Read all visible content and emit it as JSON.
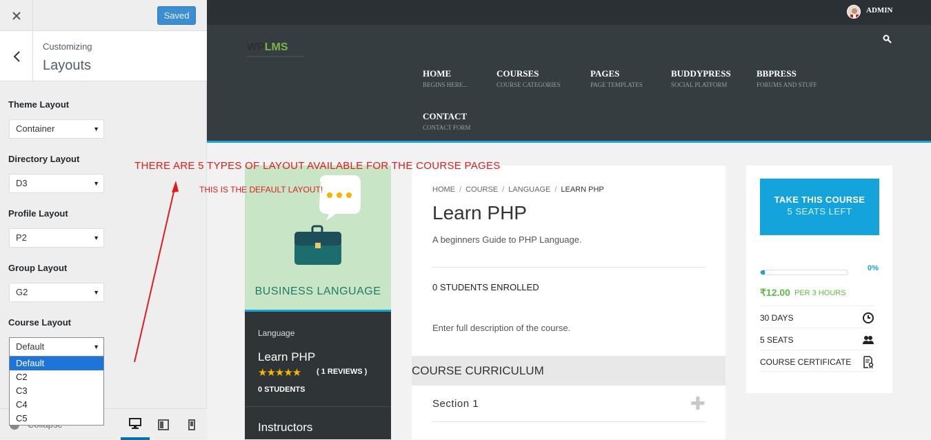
{
  "sidebar": {
    "close_icon": "close-icon",
    "saved_label": "Saved",
    "customizing_label": "Customizing",
    "section_title": "Layouts",
    "controls": [
      {
        "label": "Theme Layout",
        "value": "Container"
      },
      {
        "label": "Directory Layout",
        "value": "D3"
      },
      {
        "label": "Profile Layout",
        "value": "P2"
      },
      {
        "label": "Group Layout",
        "value": "G2"
      },
      {
        "label": "Course Layout",
        "value": "Default"
      }
    ],
    "course_layout_options": [
      "Default",
      "C2",
      "C3",
      "C4",
      "C5"
    ],
    "collapse_label": "Collapse",
    "accent_color": "#0073aa"
  },
  "preview": {
    "admin_name": "ADMIN",
    "logo": {
      "wp": "WP",
      "lms": "LMS"
    },
    "nav": [
      {
        "label": "HOME",
        "sub": "BEGINS HERE..."
      },
      {
        "label": "COURSES",
        "sub": "COURSE CATEGORIES"
      },
      {
        "label": "PAGES",
        "sub": "PAGE TEMPLATES"
      },
      {
        "label": "BUDDYPRESS",
        "sub": "SOCIAL PLATFORM"
      },
      {
        "label": "BBPRESS",
        "sub": "FORUMS AND STUFF"
      },
      {
        "label": "CONTACT",
        "sub": "CONTACT FORM"
      }
    ],
    "annotations": {
      "main": "THERE ARE 5 TYPES OF LAYOUT AVAILABLE FOR THE COURSE PAGES",
      "sub": "THIS IS THE DEFAULT LAYOUT!"
    },
    "course_card": {
      "image_caption": "BUSINESS LANGUAGE",
      "category": "Language",
      "title": "Learn PHP",
      "rating": 5,
      "reviews": "( 1 REVIEWS )",
      "students": "0 STUDENTS",
      "instructors": "Instructors"
    },
    "main": {
      "breadcrumb": [
        "HOME",
        "COURSE",
        "LANGUAGE",
        "LEARN PHP"
      ],
      "title": "Learn PHP",
      "subtitle": "A beginners Guide to PHP Language.",
      "enrolled": "0 STUDENTS ENROLLED",
      "description": "Enter full description of the course.",
      "curriculum_title": "COURSE CURRICULUM",
      "section_label": "Section 1"
    },
    "side": {
      "take_course": "TAKE THIS COURSE",
      "seats_left": "5 SEATS LEFT",
      "progress": 0.05,
      "progress_label": "0%",
      "price": "₹12.00",
      "price_unit": "PER 3 HOURS",
      "details": [
        {
          "text": "30 DAYS",
          "icon": "clock-icon"
        },
        {
          "text": "5 SEATS",
          "icon": "users-icon"
        },
        {
          "text": "COURSE CERTIFICATE",
          "icon": "certificate-icon"
        }
      ],
      "accent_color": "#14a3db",
      "price_color": "#5fb946"
    }
  }
}
